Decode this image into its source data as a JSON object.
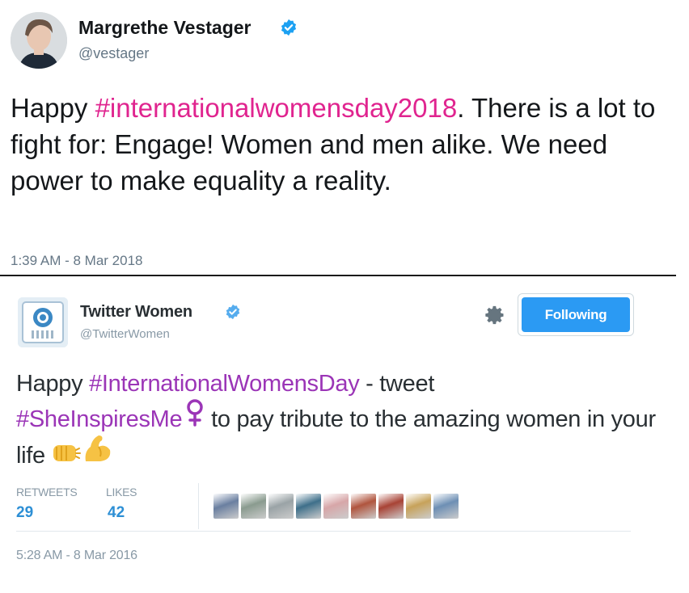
{
  "tweet1": {
    "display_name": "Margrethe Vestager",
    "handle": "@vestager",
    "text_before": "Happy ",
    "hashtag": "#internationalwomensday2018",
    "text_after": ". There is a lot to fight for: Engage! Women and men alike. We need power to make equality a reality.",
    "timestamp": "1:39 AM - 8 Mar 2018"
  },
  "tweet2": {
    "display_name": "Twitter Women",
    "handle": "@TwitterWomen",
    "follow_label": "Following",
    "text_part1": "Happy ",
    "hashtag1": "#InternationalWomensDay",
    "text_part2": " - tweet",
    "hashtag2": "#SheInspiresMe",
    "text_part3": " to pay tribute to the amazing women in your life ",
    "retweets_label": "RETWEETS",
    "retweets_count": "29",
    "likes_label": "LIKES",
    "likes_count": "42",
    "timestamp": "5:28 AM - 8 Mar 2016",
    "liker_colors": [
      "#6a7fa0",
      "#8a9b8f",
      "#9aa3a6",
      "#3e6f8a",
      "#d7a6a8",
      "#b0553e",
      "#a84335",
      "#c7a25a",
      "#6d8fb4"
    ]
  },
  "colors": {
    "verified": "#1da1f2",
    "hashtag_tweet1": "#e0248f",
    "hashtag_tweet2": "#9b35b7",
    "follow_button": "#2b9af3",
    "stat_value": "#2d8fd5"
  },
  "icons": [
    "verified-badge-icon",
    "gear-icon",
    "female-sign-icon",
    "fist-emoji-icon",
    "flexed-biceps-emoji-icon"
  ]
}
